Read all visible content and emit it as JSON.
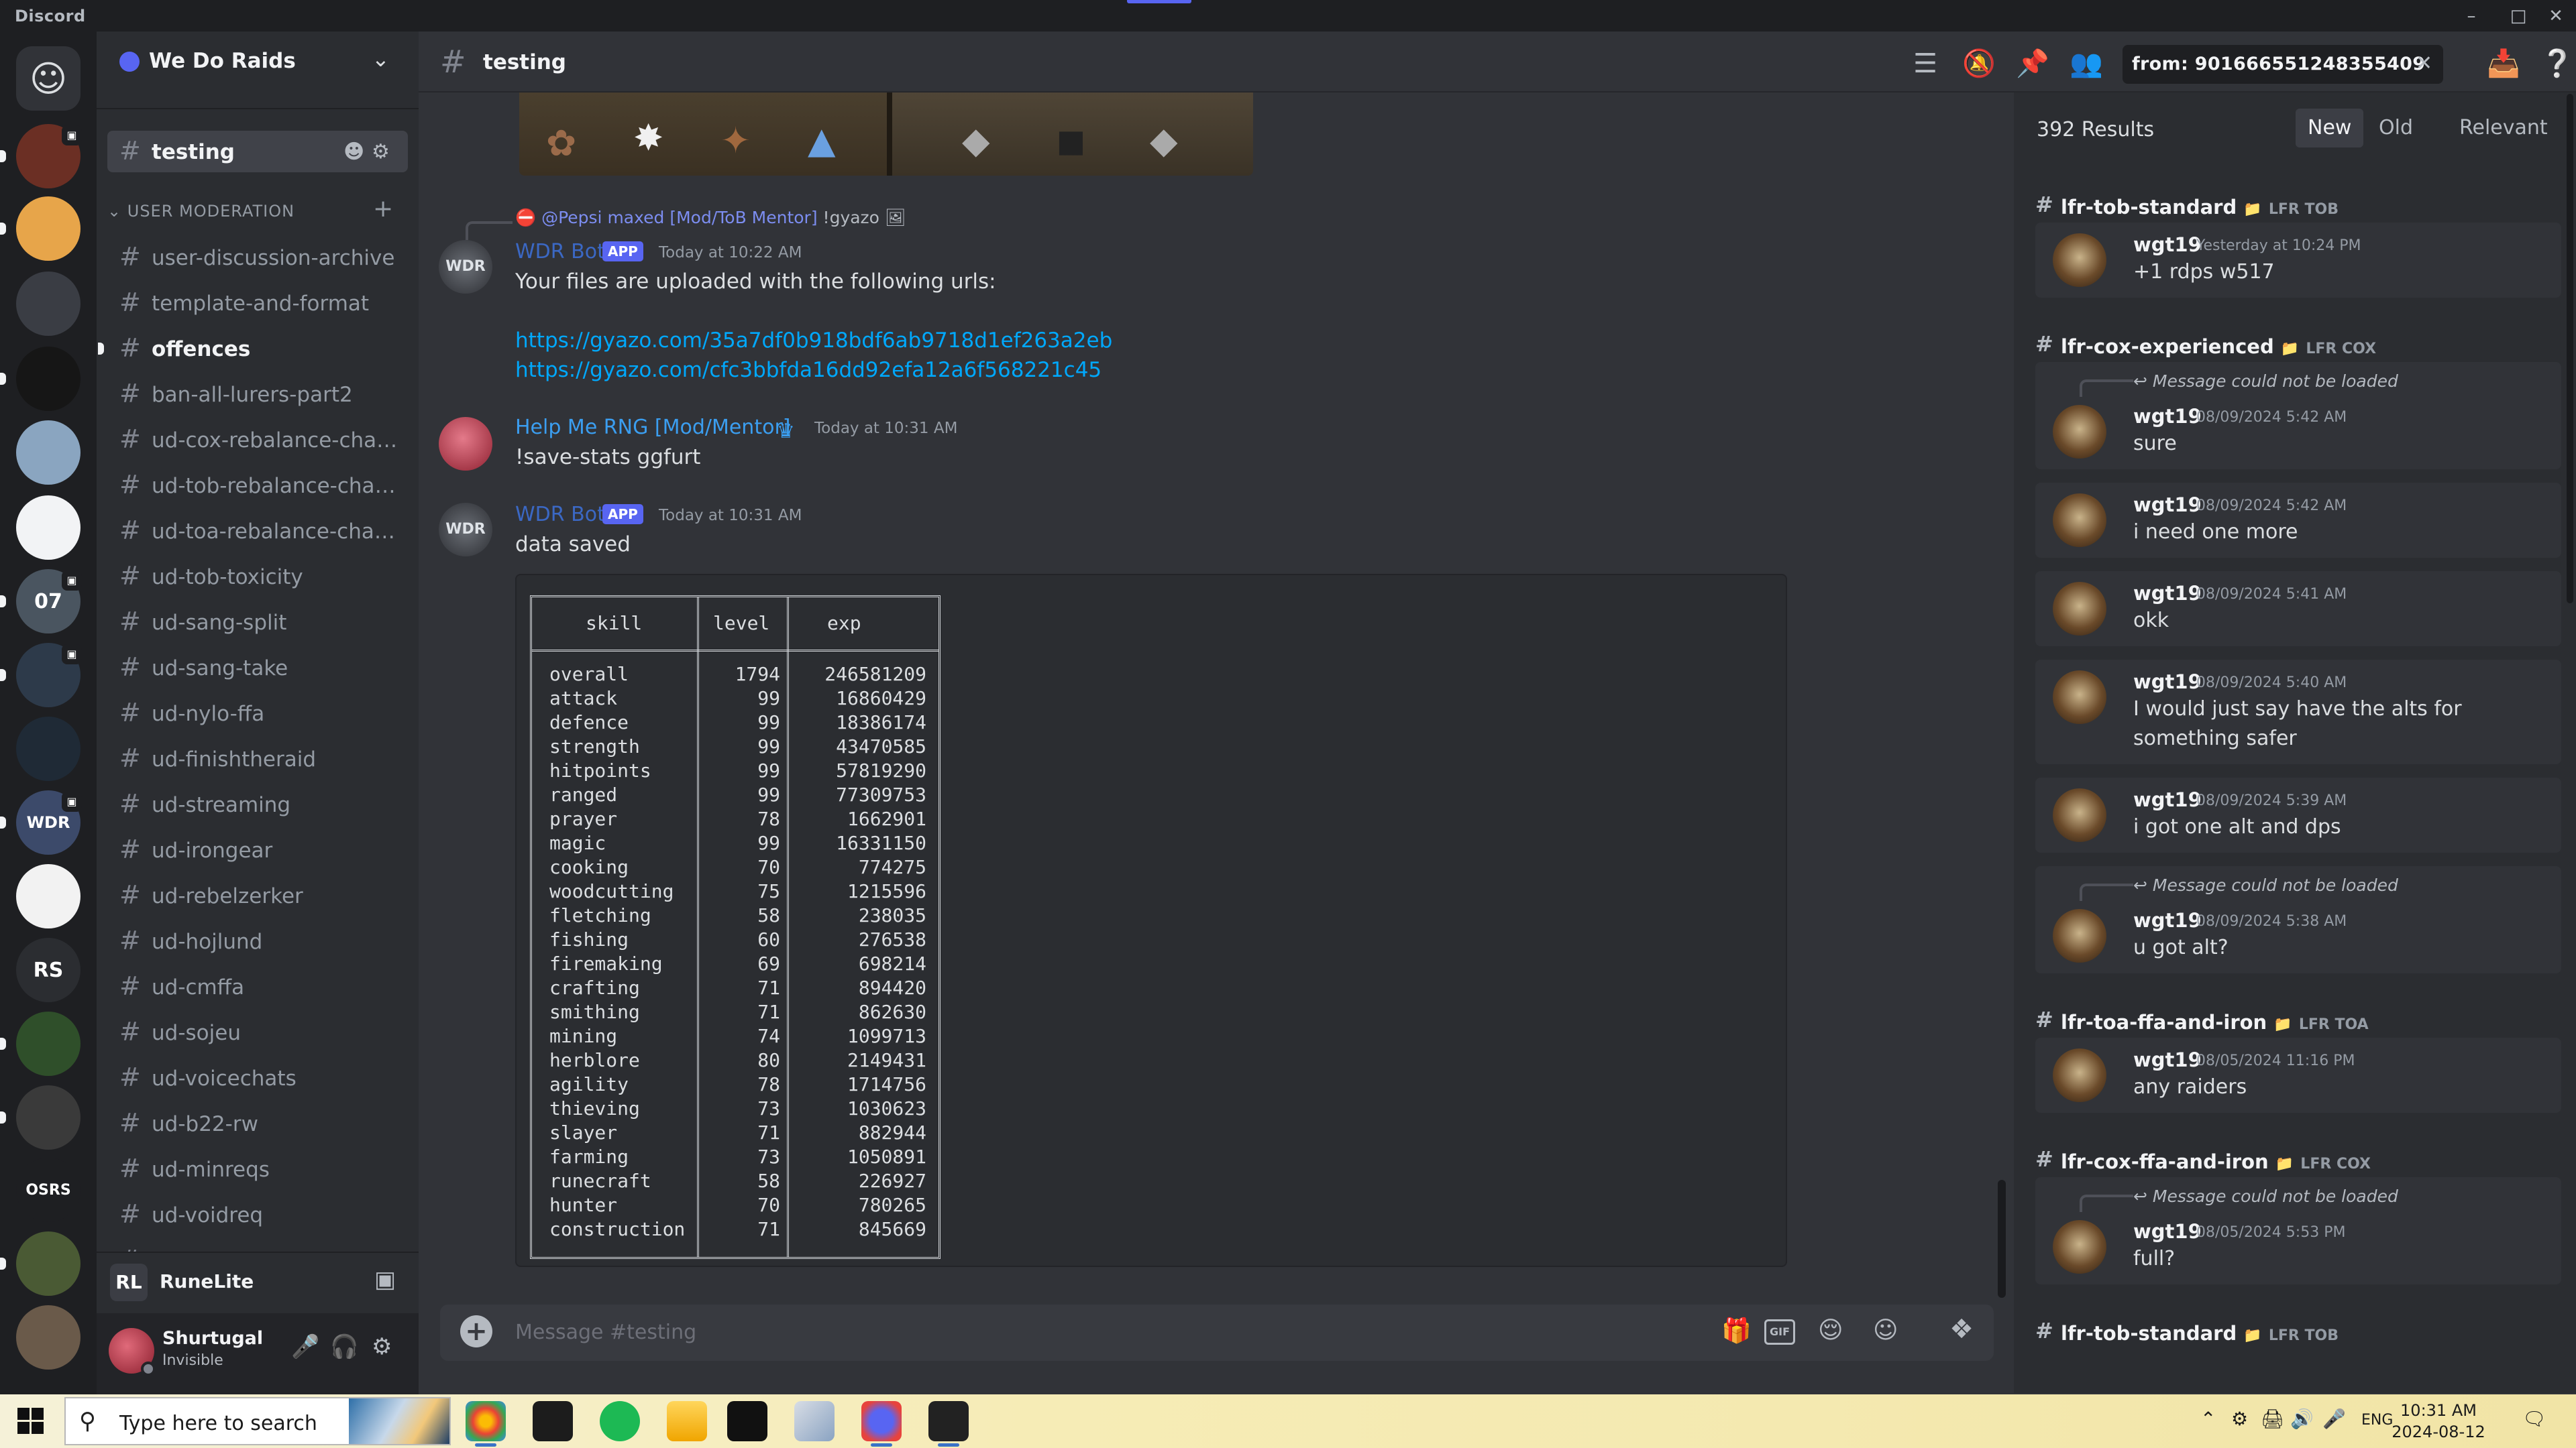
{
  "window": {
    "app_title": "Discord"
  },
  "guild": {
    "name": "We Do Raids"
  },
  "active_channel": {
    "name": "testing"
  },
  "category": {
    "name": "USER MODERATION"
  },
  "channels": [
    {
      "name": "user-discussion-archive",
      "unread": false
    },
    {
      "name": "template-and-format",
      "unread": false
    },
    {
      "name": "offences",
      "unread": true
    },
    {
      "name": "ban-all-lurers-part2",
      "unread": false
    },
    {
      "name": "ud-cox-rebalance-chang...",
      "unread": false
    },
    {
      "name": "ud-tob-rebalance-chang...",
      "unread": false
    },
    {
      "name": "ud-toa-rebalance-chang...",
      "unread": false
    },
    {
      "name": "ud-tob-toxicity",
      "unread": false
    },
    {
      "name": "ud-sang-split",
      "unread": false
    },
    {
      "name": "ud-sang-take",
      "unread": false
    },
    {
      "name": "ud-nylo-ffa",
      "unread": false
    },
    {
      "name": "ud-finishtheraid",
      "unread": false
    },
    {
      "name": "ud-streaming",
      "unread": false
    },
    {
      "name": "ud-irongear",
      "unread": false
    },
    {
      "name": "ud-rebelzerker",
      "unread": false
    },
    {
      "name": "ud-hojlund",
      "unread": false
    },
    {
      "name": "ud-cmffa",
      "unread": false
    },
    {
      "name": "ud-sojeu",
      "unread": false
    },
    {
      "name": "ud-voicechats",
      "unread": false
    },
    {
      "name": "ud-b22-rw",
      "unread": false
    },
    {
      "name": "ud-minreqs",
      "unread": false
    },
    {
      "name": "ud-voidreq",
      "unread": false
    },
    {
      "name": "ud-coxkick",
      "unread": false
    }
  ],
  "servers": [
    {
      "label": "",
      "color": "#2b2d31"
    },
    {
      "label": "",
      "color": "#6b2f24"
    },
    {
      "label": "",
      "color": "#e7a54a"
    },
    {
      "label": "",
      "color": "#3a3d44"
    },
    {
      "label": "",
      "color": "#161616"
    },
    {
      "label": "",
      "color": "#8aa5c0"
    },
    {
      "label": "",
      "color": "#f2f3f5"
    },
    {
      "label": "07",
      "color": "#4a5560"
    },
    {
      "label": "",
      "color": "#2d3a4a"
    },
    {
      "label": "",
      "color": "#1f2a36"
    },
    {
      "label": "WDR",
      "color": "#3c4a6a"
    },
    {
      "label": "",
      "color": "#f2f2f2"
    },
    {
      "label": "RS",
      "color": "#2b2d31"
    },
    {
      "label": "",
      "color": "#2f4f2a"
    },
    {
      "label": "",
      "color": "#3a3a3a"
    },
    {
      "label": "OSRS",
      "color": "#1e1f22"
    },
    {
      "label": "",
      "color": "#4a5a34"
    },
    {
      "label": "",
      "color": "#6a5a4a"
    }
  ],
  "runelite": {
    "name": "RuneLite",
    "logo": "RL"
  },
  "user": {
    "name": "Shurtugal",
    "status": "Invisible"
  },
  "search": {
    "query": "from: 901666551248355409"
  },
  "messages": {
    "reply_ref": {
      "mention": "@Pepsi maxed [Mod/ToB Mentor]",
      "text": "!gyazo"
    },
    "m1": {
      "author": "WDR Bot",
      "badge": "APP",
      "time": "Today at 10:22 AM",
      "text": "Your files are uploaded with the following urls:",
      "links": [
        "https://gyazo.com/35a7df0b918bdf6ab9718d1ef263a2eb",
        "https://gyazo.com/cfc3bbfda16dd92efa12a6f568221c45"
      ]
    },
    "m2": {
      "author": "Help Me RNG [Mod/Mentor]",
      "time": "Today at 10:31 AM",
      "text": "!save-stats ggfurt"
    },
    "m3": {
      "author": "WDR Bot",
      "badge": "APP",
      "time": "Today at 10:31 AM",
      "text": "data saved"
    }
  },
  "stats_table": {
    "headers": [
      "skill",
      "level",
      "exp"
    ],
    "rows": [
      [
        "overall",
        "1794",
        "246581209"
      ],
      [
        "attack",
        "99",
        "16860429"
      ],
      [
        "defence",
        "99",
        "18386174"
      ],
      [
        "strength",
        "99",
        "43470585"
      ],
      [
        "hitpoints",
        "99",
        "57819290"
      ],
      [
        "ranged",
        "99",
        "77309753"
      ],
      [
        "prayer",
        "78",
        "1662901"
      ],
      [
        "magic",
        "99",
        "16331150"
      ],
      [
        "cooking",
        "70",
        "774275"
      ],
      [
        "woodcutting",
        "75",
        "1215596"
      ],
      [
        "fletching",
        "58",
        "238035"
      ],
      [
        "fishing",
        "60",
        "276538"
      ],
      [
        "firemaking",
        "69",
        "698214"
      ],
      [
        "crafting",
        "71",
        "894420"
      ],
      [
        "smithing",
        "71",
        "862630"
      ],
      [
        "mining",
        "74",
        "1099713"
      ],
      [
        "herblore",
        "80",
        "2149431"
      ],
      [
        "agility",
        "78",
        "1714756"
      ],
      [
        "thieving",
        "73",
        "1030623"
      ],
      [
        "slayer",
        "71",
        "882944"
      ],
      [
        "farming",
        "73",
        "1050891"
      ],
      [
        "runecraft",
        "58",
        "226927"
      ],
      [
        "hunter",
        "70",
        "780265"
      ],
      [
        "construction",
        "71",
        "845669"
      ]
    ]
  },
  "composer": {
    "placeholder": "Message #testing"
  },
  "results": {
    "count": "392 Results",
    "sort": [
      "New",
      "Old",
      "Relevant"
    ],
    "not_loaded": "Message could not be loaded",
    "groups": [
      {
        "channel": "lfr-tob-standard",
        "category": "LFR TOB",
        "items": [
          {
            "author": "wgt19",
            "time": "Yesterday at 10:24 PM",
            "text": "+1 rdps w517",
            "reply": false
          }
        ]
      },
      {
        "channel": "lfr-cox-experienced",
        "category": "LFR COX",
        "items": [
          {
            "author": "wgt19",
            "time": "08/09/2024 5:42 AM",
            "text": "sure",
            "reply": true
          },
          {
            "author": "wgt19",
            "time": "08/09/2024 5:42 AM",
            "text": "i need one more",
            "reply": false
          },
          {
            "author": "wgt19",
            "time": "08/09/2024 5:41 AM",
            "text": "okk",
            "reply": false
          },
          {
            "author": "wgt19",
            "time": "08/09/2024 5:40 AM",
            "text": "I would just say have the alts for something safer",
            "reply": false
          },
          {
            "author": "wgt19",
            "time": "08/09/2024 5:39 AM",
            "text": "i got one alt and dps",
            "reply": false
          },
          {
            "author": "wgt19",
            "time": "08/09/2024 5:38 AM",
            "text": "u got alt?",
            "reply": true
          }
        ]
      },
      {
        "channel": "lfr-toa-ffa-and-iron",
        "category": "LFR TOA",
        "items": [
          {
            "author": "wgt19",
            "time": "08/05/2024 11:16 PM",
            "text": "any raiders",
            "reply": false
          }
        ]
      },
      {
        "channel": "lfr-cox-ffa-and-iron",
        "category": "LFR COX",
        "items": [
          {
            "author": "wgt19",
            "time": "08/05/2024 5:53 PM",
            "text": "full?",
            "reply": true
          }
        ]
      },
      {
        "channel": "lfr-tob-standard",
        "category": "LFR TOB",
        "items": []
      }
    ]
  },
  "taskbar": {
    "search_placeholder": "Type here to search",
    "lang": "ENG",
    "time": "10:31 AM",
    "date": "2024-08-12"
  }
}
